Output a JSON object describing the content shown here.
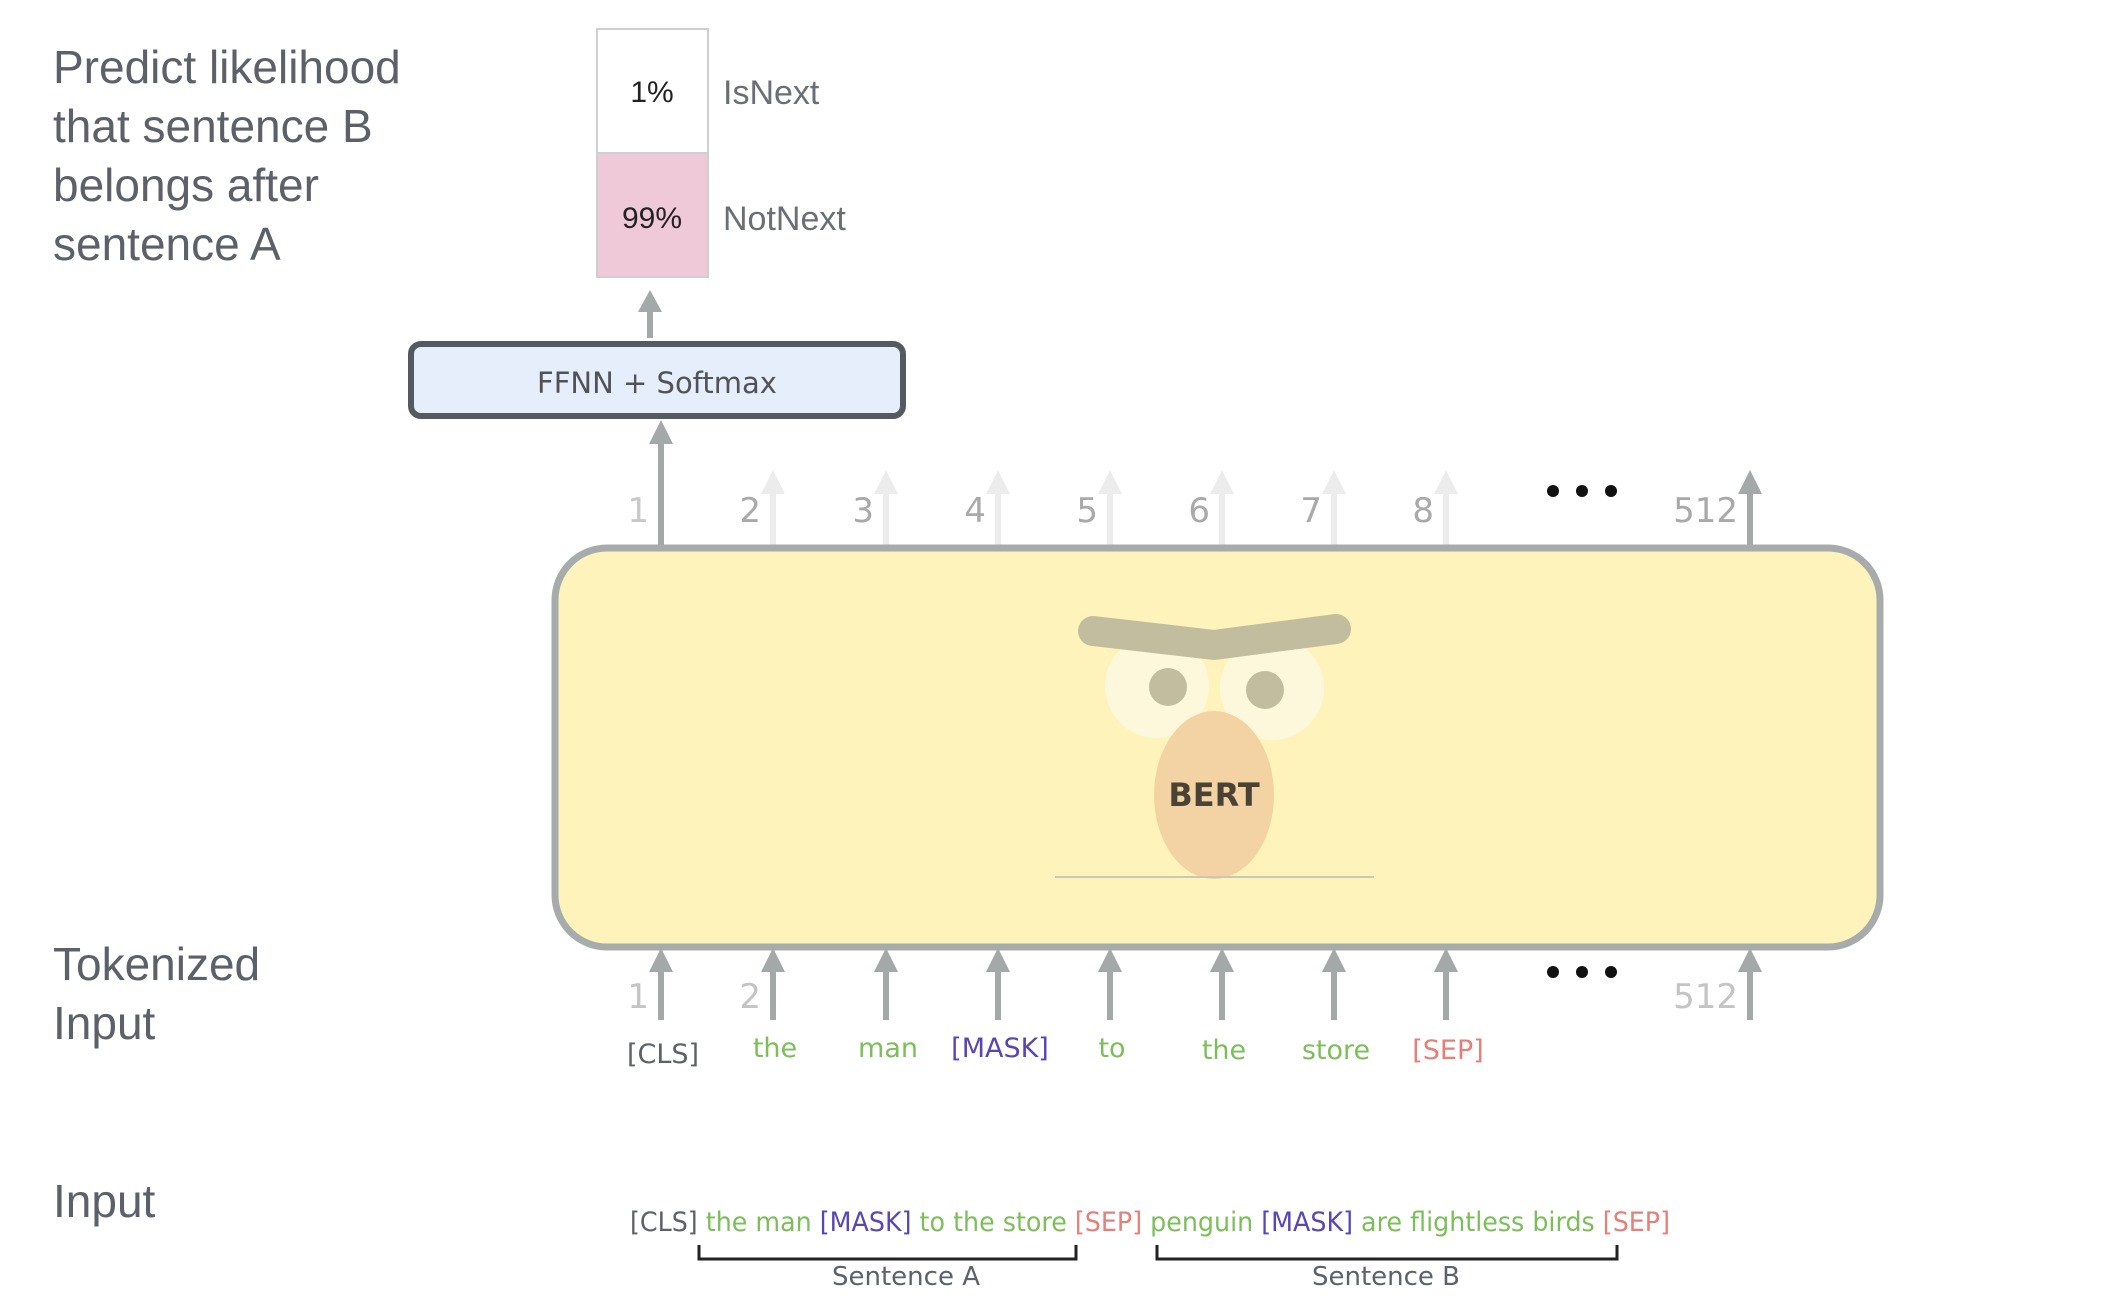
{
  "labels": {
    "predict": [
      "Predict likelihood",
      "that sentence B",
      "belongs after",
      "sentence A"
    ],
    "tokenized": [
      "Tokenized",
      "Input"
    ],
    "input": "Input"
  },
  "prediction": {
    "classes": [
      {
        "name": "IsNext",
        "probability_label": "1%",
        "probability": 0.01,
        "highlighted": false
      },
      {
        "name": "NotNext",
        "probability_label": "99%",
        "probability": 0.99,
        "highlighted": true
      }
    ]
  },
  "ffnn_label": "FFNN + Softmax",
  "model_name": "BERT",
  "output_positions": {
    "labels": [
      "1",
      "2",
      "3",
      "4",
      "5",
      "6",
      "7",
      "8",
      "512"
    ],
    "active": [
      true,
      false,
      false,
      false,
      false,
      false,
      false,
      false,
      true
    ],
    "ellipsis": "•••"
  },
  "input_positions": {
    "labels": [
      "1",
      "2",
      "",
      "",
      "",
      "",
      "",
      "",
      "512"
    ],
    "ellipsis": "•••"
  },
  "tokens": [
    {
      "text": "[CLS]",
      "kind": "special"
    },
    {
      "text": "the",
      "kind": "word"
    },
    {
      "text": "man",
      "kind": "word"
    },
    {
      "text": "[MASK]",
      "kind": "mask"
    },
    {
      "text": "to",
      "kind": "word"
    },
    {
      "text": "the",
      "kind": "word"
    },
    {
      "text": "store",
      "kind": "word"
    },
    {
      "text": "[SEP]",
      "kind": "sep"
    }
  ],
  "input_sentence": [
    {
      "text": "[CLS]",
      "kind": "special"
    },
    {
      "text": "the man",
      "kind": "word"
    },
    {
      "text": "[MASK]",
      "kind": "mask"
    },
    {
      "text": "to the store",
      "kind": "word"
    },
    {
      "text": "[SEP]",
      "kind": "sep"
    },
    {
      "text": "penguin",
      "kind": "word"
    },
    {
      "text": "[MASK]",
      "kind": "mask"
    },
    {
      "text": "are flightless birds",
      "kind": "word"
    },
    {
      "text": "[SEP]",
      "kind": "sep"
    }
  ],
  "segments": [
    {
      "label": "Sentence A"
    },
    {
      "label": "Sentence B"
    }
  ],
  "colors": {
    "special": "#5d6168",
    "word": "#7cbf5a",
    "mask": "#5a45b5",
    "sep": "#e57f78",
    "highlight_fill": "#f0c9d8",
    "bert_fill": "#fdf3bb",
    "ffnn_fill": "#e6edfb"
  }
}
